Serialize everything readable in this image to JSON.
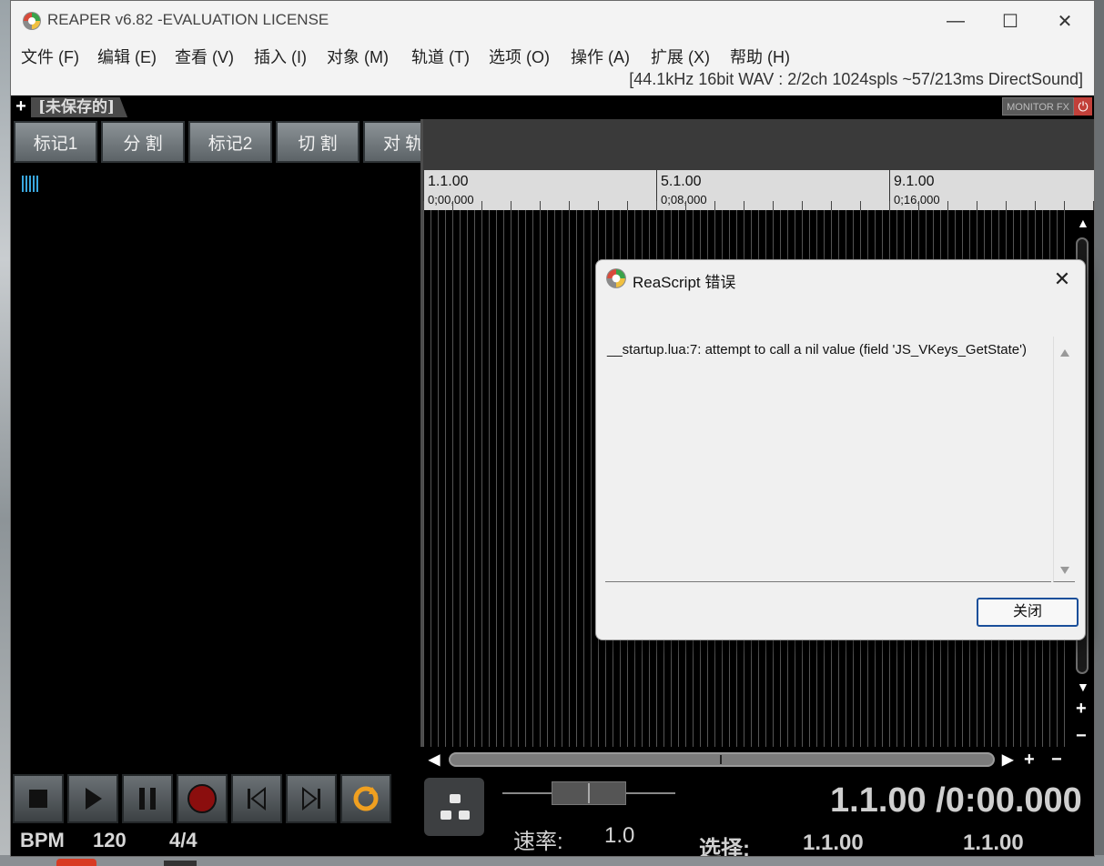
{
  "window": {
    "title": "REAPER v6.82 -EVALUATION LICENSE",
    "minimize_glyph": "—",
    "maximize_glyph": "☐",
    "close_glyph": "✕"
  },
  "menu": [
    "文件 (F)",
    "编辑 (E)",
    "查看 (V)",
    "插入 (I)",
    "对象 (M)",
    "轨道 (T)",
    "选项 (O)",
    "操作 (A)",
    "扩展 (X)",
    "帮助 (H)"
  ],
  "audio_status": "[44.1kHz 16bit WAV : 2/2ch 1024spls ~57/213ms DirectSound]",
  "project_tab": {
    "add": "+",
    "name": "[未保存的]",
    "monitor_fx": "MONITOR FX",
    "power_glyph": "⏻"
  },
  "toolbar": [
    "标记1",
    "分 割",
    "标记2",
    "切 割",
    "对 轨"
  ],
  "ruler": {
    "markers": [
      {
        "bar": "1.1.00",
        "time": "0;00,000"
      },
      {
        "bar": "5.1.00",
        "time": "0;08,000"
      },
      {
        "bar": "9.1.00",
        "time": "0;16,000"
      }
    ]
  },
  "scroll": {
    "up": "▲",
    "down": "▼",
    "left": "◀",
    "right": "▶",
    "zoom_in": "+",
    "zoom_out": "−"
  },
  "transport": {
    "bpm_label": "BPM",
    "bpm_value": "120",
    "time_sig": "4/4",
    "rate_label": "速率:",
    "rate_value": "1.0",
    "position": "1.1.00 /0:00.000",
    "selection_label": "选择:",
    "selection_start": "1.1.00",
    "selection_end": "1.1.00"
  },
  "dialog": {
    "title": "ReaScript 错误",
    "close_glyph": "✕",
    "message": "__startup.lua:7: attempt to call a nil value (field 'JS_VKeys_GetState')",
    "ok_label": "关闭"
  },
  "colors": {
    "accent_blue": "#3aa8e0",
    "record_red": "#8b0e0e",
    "loop_orange": "#f0a020"
  }
}
